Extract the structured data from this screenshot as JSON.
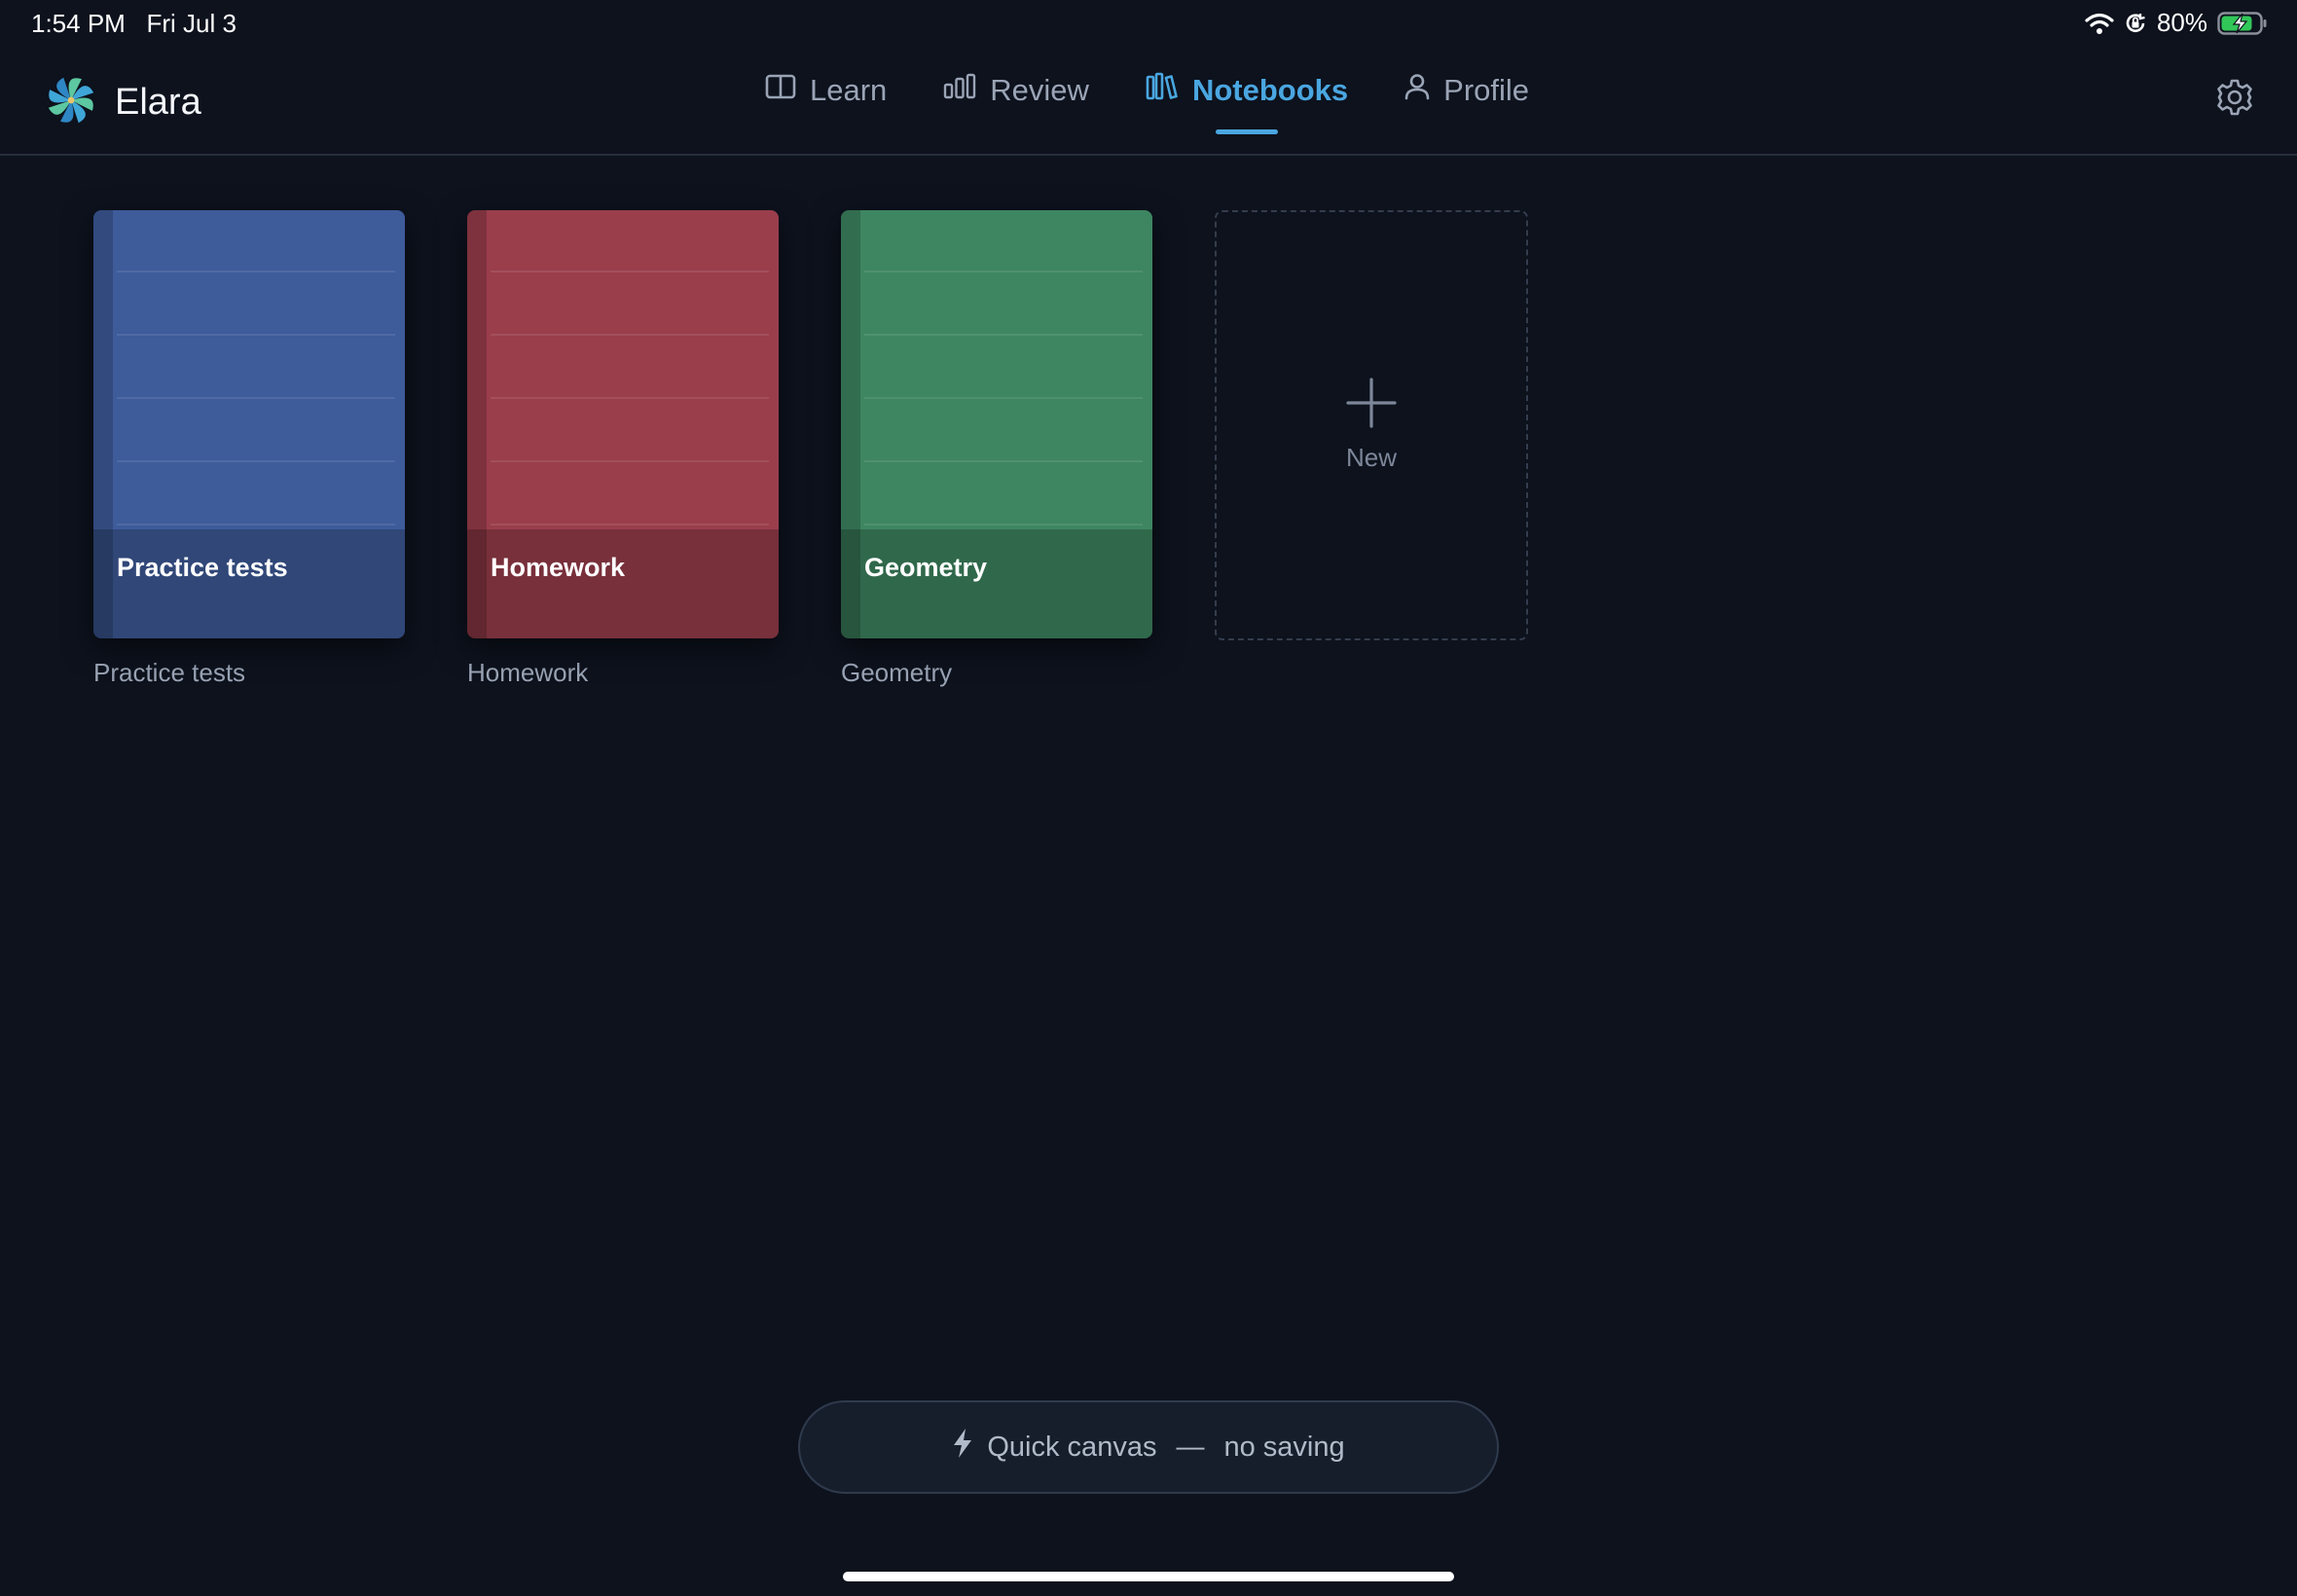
{
  "status_bar": {
    "time": "1:54 PM",
    "date": "Fri Jul 3",
    "battery_percent": "80%",
    "icons": [
      "wifi-icon",
      "orientation-lock-icon",
      "battery-charging-icon"
    ]
  },
  "app": {
    "name": "Elara",
    "logo_icon": "pinwheel-logo-icon"
  },
  "nav": {
    "items": [
      {
        "label": "Learn",
        "icon": "book-open-icon",
        "active": false
      },
      {
        "label": "Review",
        "icon": "bar-chart-icon",
        "active": false
      },
      {
        "label": "Notebooks",
        "icon": "library-icon",
        "active": true
      },
      {
        "label": "Profile",
        "icon": "user-icon",
        "active": false
      }
    ],
    "accent_color": "#4aa6e0"
  },
  "notebooks": [
    {
      "cover_title": "Practice tests",
      "caption": "Practice tests",
      "color": "#3e5b9a"
    },
    {
      "cover_title": "Homework",
      "caption": "Homework",
      "color": "#9a3e4c"
    },
    {
      "cover_title": "Geometry",
      "caption": "Geometry",
      "color": "#3e8661"
    }
  ],
  "new_notebook": {
    "label": "New",
    "icon": "plus-icon"
  },
  "quick_canvas": {
    "label": "Quick canvas",
    "dash": "—",
    "subtext": "no saving",
    "icon": "lightning-icon"
  }
}
